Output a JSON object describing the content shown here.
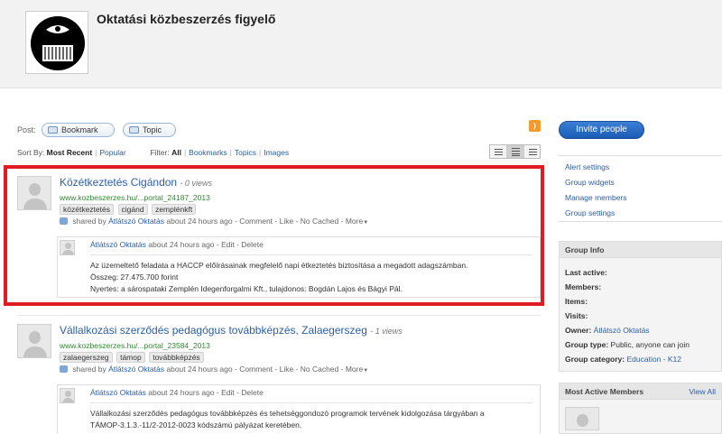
{
  "header": {
    "title": "Oktatási közbeszerzés figyelő"
  },
  "post_bar": {
    "label": "Post:",
    "bookmark": "Bookmark",
    "topic": "Topic"
  },
  "sort": {
    "label": "Sort By:",
    "most_recent": "Most Recent",
    "popular": "Popular",
    "filter_label": "Filter:",
    "filters": [
      "All",
      "Bookmarks",
      "Topics",
      "Images"
    ]
  },
  "items": [
    {
      "title": "Közétkeztetés Cigándon",
      "views": "- 0 views",
      "url": "www.kozbeszerzes.hu/...portal_24187_2013",
      "tags": [
        "közétkeztetés",
        "cigánd",
        "zemplénkft"
      ],
      "shared_prefix": "shared by",
      "author": "Átlátszó Oktatás",
      "time": "about 24 hours ago",
      "actions": "- Comment - Like - No Cached - More",
      "comment": {
        "author": "Átlátszó Oktatás",
        "time": "about 24 hours ago",
        "actions": "- Edit - Delete",
        "lines": [
          "Az üzemeltető feladata a HACCP előírásainak megfelelő napi étkeztetés biztosítása a megadott adagszámban.",
          "Összeg: 27.475.700 forint",
          "Nyertes: a sárospataki Zemplén Idegenforgalmi Kft., tulajdonos: Bogdán Lajos és Bágyi Pál."
        ]
      }
    },
    {
      "title": "Vállalkozási szerződés pedagógus továbbképzés, Zalaegerszeg",
      "views": "- 1 views",
      "url": "www.kozbeszerzes.hu/...portal_23584_2013",
      "tags": [
        "zalaegerszeg",
        "támop",
        "továbbképzés"
      ],
      "shared_prefix": "shared by",
      "author": "Átlátszó Oktatás",
      "time": "about 24 hours ago",
      "actions": "- Comment - Like - No Cached - More",
      "comment": {
        "author": "Átlátszó Oktatás",
        "time": "about 24 hours ago",
        "actions": "- Edit - Delete",
        "lines": [
          "Vállalkozási szerződés pedagógus továbbképzés és tehetséggondozó programok tervének kidolgozása tárgyában a",
          "TÁMOP-3.1.3.-11/2-2012-0023 kódszámú pályázat keretében."
        ]
      }
    }
  ],
  "sidebar": {
    "invite": "Invite people",
    "links": [
      "Alert settings",
      "Group widgets",
      "Manage members",
      "Group settings"
    ],
    "group_info": {
      "title": "Group Info",
      "last_active": "Last active:",
      "members": "Members:",
      "items": "Items:",
      "visits": "Visits:",
      "owner_label": "Owner:",
      "owner": "Átlátszó Oktatás",
      "type_label": "Group type:",
      "type": "Public, anyone can join",
      "category_label": "Group category:",
      "category": "Education - K12"
    },
    "active_members": {
      "title": "Most Active Members",
      "view_all": "View All"
    }
  },
  "icons": {
    "rss": "rss-icon",
    "share": "share-icon",
    "list_view": "list-view-icon"
  },
  "colors": {
    "highlight": "#e01b24",
    "link": "#2b5ea8",
    "url": "#2e8b2e",
    "invite": "#1a5cb5"
  }
}
